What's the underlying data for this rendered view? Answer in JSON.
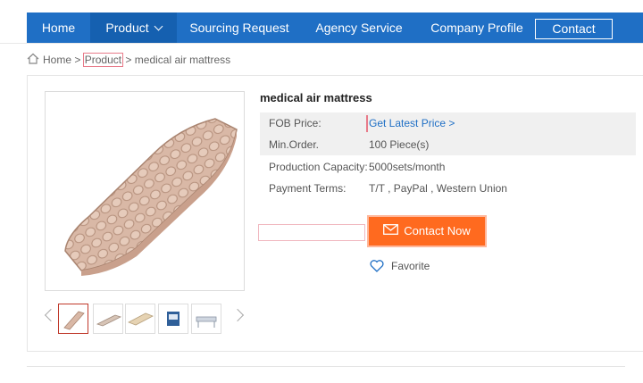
{
  "nav": {
    "items": [
      {
        "label": "Home"
      },
      {
        "label": "Product"
      },
      {
        "label": "Sourcing Request"
      },
      {
        "label": "Agency Service"
      },
      {
        "label": "Company Profile"
      }
    ],
    "contact_label": "Contact"
  },
  "breadcrumb": {
    "home": "Home",
    "sep1": ">",
    "product": "Product",
    "sep2": ">",
    "current": "medical air mattress"
  },
  "product": {
    "title": "medical air mattress",
    "specs": [
      {
        "label": "FOB Price:",
        "value": "Get Latest Price >"
      },
      {
        "label": "Min.Order.",
        "value": "100 Piece(s)"
      },
      {
        "label": "Production Capacity:",
        "value": "5000sets/month"
      },
      {
        "label": "Payment Terms:",
        "value": "T/T , PayPal , Western Union"
      }
    ],
    "contact_button": "Contact Now",
    "favorite_label": "Favorite"
  },
  "colors": {
    "nav_bg": "#1f6fc5",
    "accent_orange": "#ff6a1f",
    "link_blue": "#1f6fc5"
  }
}
